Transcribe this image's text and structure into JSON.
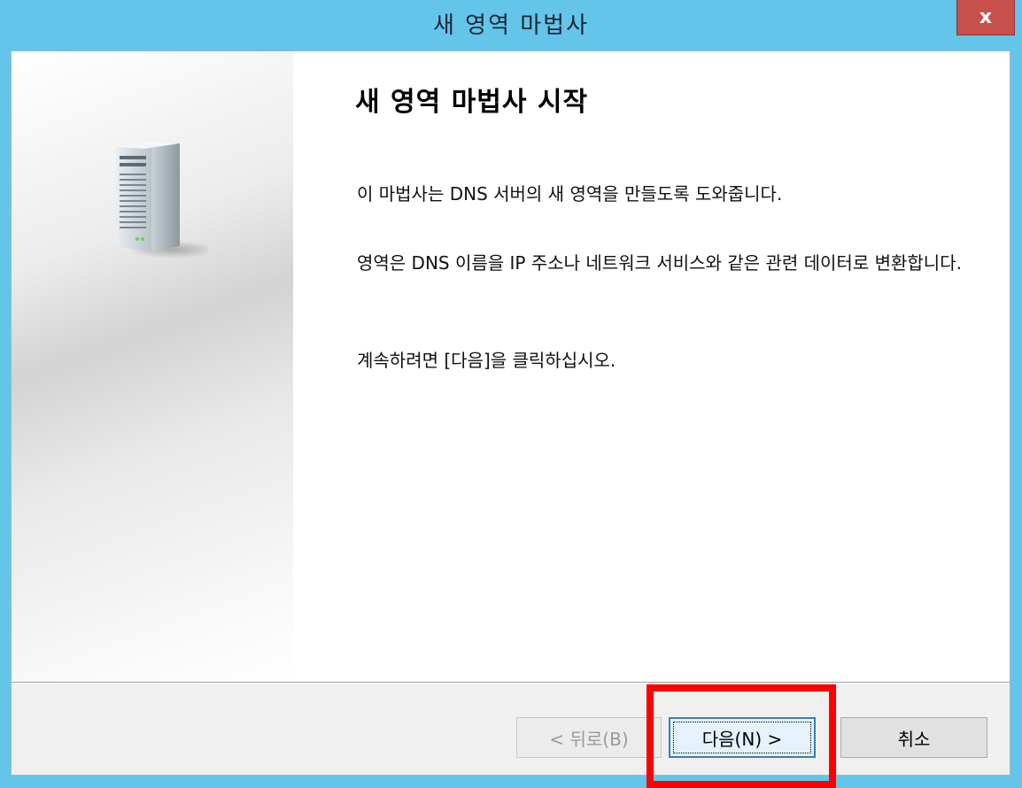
{
  "window": {
    "title": "새 영역 마법사",
    "close_label": "x"
  },
  "wizard": {
    "heading": "새 영역 마법사 시작",
    "paragraph1": "이 마법사는 DNS 서버의 새 영역을 만들도록 도와줍니다.",
    "paragraph2": "영역은 DNS 이름을 IP 주소나 네트워크 서비스와 같은 관련 데이터로 변환합니다.",
    "paragraph3": "계속하려면 [다음]을 클릭하십시오.",
    "side_icon": "server-icon"
  },
  "buttons": {
    "back": "< 뒤로(B)",
    "next": "다음(N) >",
    "cancel": "취소"
  },
  "colors": {
    "title_bar": "#63c5ea",
    "close_button": "#c7504b",
    "highlight": "#ff0000"
  }
}
